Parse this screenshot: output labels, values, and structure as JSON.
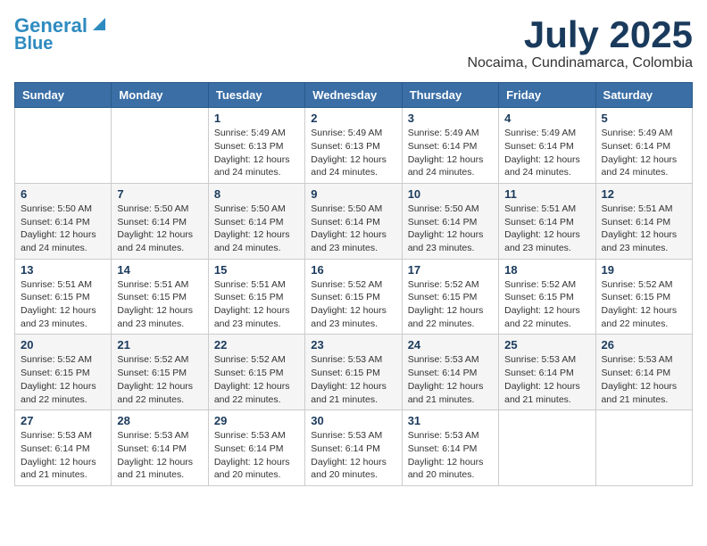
{
  "logo": {
    "line1": "General",
    "line2": "Blue"
  },
  "title": {
    "month": "July 2025",
    "location": "Nocaima, Cundinamarca, Colombia"
  },
  "headers": [
    "Sunday",
    "Monday",
    "Tuesday",
    "Wednesday",
    "Thursday",
    "Friday",
    "Saturday"
  ],
  "weeks": [
    [
      {
        "day": "",
        "info": ""
      },
      {
        "day": "",
        "info": ""
      },
      {
        "day": "1",
        "sunrise": "Sunrise: 5:49 AM",
        "sunset": "Sunset: 6:13 PM",
        "daylight": "Daylight: 12 hours and 24 minutes."
      },
      {
        "day": "2",
        "sunrise": "Sunrise: 5:49 AM",
        "sunset": "Sunset: 6:13 PM",
        "daylight": "Daylight: 12 hours and 24 minutes."
      },
      {
        "day": "3",
        "sunrise": "Sunrise: 5:49 AM",
        "sunset": "Sunset: 6:14 PM",
        "daylight": "Daylight: 12 hours and 24 minutes."
      },
      {
        "day": "4",
        "sunrise": "Sunrise: 5:49 AM",
        "sunset": "Sunset: 6:14 PM",
        "daylight": "Daylight: 12 hours and 24 minutes."
      },
      {
        "day": "5",
        "sunrise": "Sunrise: 5:49 AM",
        "sunset": "Sunset: 6:14 PM",
        "daylight": "Daylight: 12 hours and 24 minutes."
      }
    ],
    [
      {
        "day": "6",
        "sunrise": "Sunrise: 5:50 AM",
        "sunset": "Sunset: 6:14 PM",
        "daylight": "Daylight: 12 hours and 24 minutes."
      },
      {
        "day": "7",
        "sunrise": "Sunrise: 5:50 AM",
        "sunset": "Sunset: 6:14 PM",
        "daylight": "Daylight: 12 hours and 24 minutes."
      },
      {
        "day": "8",
        "sunrise": "Sunrise: 5:50 AM",
        "sunset": "Sunset: 6:14 PM",
        "daylight": "Daylight: 12 hours and 24 minutes."
      },
      {
        "day": "9",
        "sunrise": "Sunrise: 5:50 AM",
        "sunset": "Sunset: 6:14 PM",
        "daylight": "Daylight: 12 hours and 23 minutes."
      },
      {
        "day": "10",
        "sunrise": "Sunrise: 5:50 AM",
        "sunset": "Sunset: 6:14 PM",
        "daylight": "Daylight: 12 hours and 23 minutes."
      },
      {
        "day": "11",
        "sunrise": "Sunrise: 5:51 AM",
        "sunset": "Sunset: 6:14 PM",
        "daylight": "Daylight: 12 hours and 23 minutes."
      },
      {
        "day": "12",
        "sunrise": "Sunrise: 5:51 AM",
        "sunset": "Sunset: 6:14 PM",
        "daylight": "Daylight: 12 hours and 23 minutes."
      }
    ],
    [
      {
        "day": "13",
        "sunrise": "Sunrise: 5:51 AM",
        "sunset": "Sunset: 6:15 PM",
        "daylight": "Daylight: 12 hours and 23 minutes."
      },
      {
        "day": "14",
        "sunrise": "Sunrise: 5:51 AM",
        "sunset": "Sunset: 6:15 PM",
        "daylight": "Daylight: 12 hours and 23 minutes."
      },
      {
        "day": "15",
        "sunrise": "Sunrise: 5:51 AM",
        "sunset": "Sunset: 6:15 PM",
        "daylight": "Daylight: 12 hours and 23 minutes."
      },
      {
        "day": "16",
        "sunrise": "Sunrise: 5:52 AM",
        "sunset": "Sunset: 6:15 PM",
        "daylight": "Daylight: 12 hours and 23 minutes."
      },
      {
        "day": "17",
        "sunrise": "Sunrise: 5:52 AM",
        "sunset": "Sunset: 6:15 PM",
        "daylight": "Daylight: 12 hours and 22 minutes."
      },
      {
        "day": "18",
        "sunrise": "Sunrise: 5:52 AM",
        "sunset": "Sunset: 6:15 PM",
        "daylight": "Daylight: 12 hours and 22 minutes."
      },
      {
        "day": "19",
        "sunrise": "Sunrise: 5:52 AM",
        "sunset": "Sunset: 6:15 PM",
        "daylight": "Daylight: 12 hours and 22 minutes."
      }
    ],
    [
      {
        "day": "20",
        "sunrise": "Sunrise: 5:52 AM",
        "sunset": "Sunset: 6:15 PM",
        "daylight": "Daylight: 12 hours and 22 minutes."
      },
      {
        "day": "21",
        "sunrise": "Sunrise: 5:52 AM",
        "sunset": "Sunset: 6:15 PM",
        "daylight": "Daylight: 12 hours and 22 minutes."
      },
      {
        "day": "22",
        "sunrise": "Sunrise: 5:52 AM",
        "sunset": "Sunset: 6:15 PM",
        "daylight": "Daylight: 12 hours and 22 minutes."
      },
      {
        "day": "23",
        "sunrise": "Sunrise: 5:53 AM",
        "sunset": "Sunset: 6:15 PM",
        "daylight": "Daylight: 12 hours and 21 minutes."
      },
      {
        "day": "24",
        "sunrise": "Sunrise: 5:53 AM",
        "sunset": "Sunset: 6:14 PM",
        "daylight": "Daylight: 12 hours and 21 minutes."
      },
      {
        "day": "25",
        "sunrise": "Sunrise: 5:53 AM",
        "sunset": "Sunset: 6:14 PM",
        "daylight": "Daylight: 12 hours and 21 minutes."
      },
      {
        "day": "26",
        "sunrise": "Sunrise: 5:53 AM",
        "sunset": "Sunset: 6:14 PM",
        "daylight": "Daylight: 12 hours and 21 minutes."
      }
    ],
    [
      {
        "day": "27",
        "sunrise": "Sunrise: 5:53 AM",
        "sunset": "Sunset: 6:14 PM",
        "daylight": "Daylight: 12 hours and 21 minutes."
      },
      {
        "day": "28",
        "sunrise": "Sunrise: 5:53 AM",
        "sunset": "Sunset: 6:14 PM",
        "daylight": "Daylight: 12 hours and 21 minutes."
      },
      {
        "day": "29",
        "sunrise": "Sunrise: 5:53 AM",
        "sunset": "Sunset: 6:14 PM",
        "daylight": "Daylight: 12 hours and 20 minutes."
      },
      {
        "day": "30",
        "sunrise": "Sunrise: 5:53 AM",
        "sunset": "Sunset: 6:14 PM",
        "daylight": "Daylight: 12 hours and 20 minutes."
      },
      {
        "day": "31",
        "sunrise": "Sunrise: 5:53 AM",
        "sunset": "Sunset: 6:14 PM",
        "daylight": "Daylight: 12 hours and 20 minutes."
      },
      {
        "day": "",
        "info": ""
      },
      {
        "day": "",
        "info": ""
      }
    ]
  ]
}
